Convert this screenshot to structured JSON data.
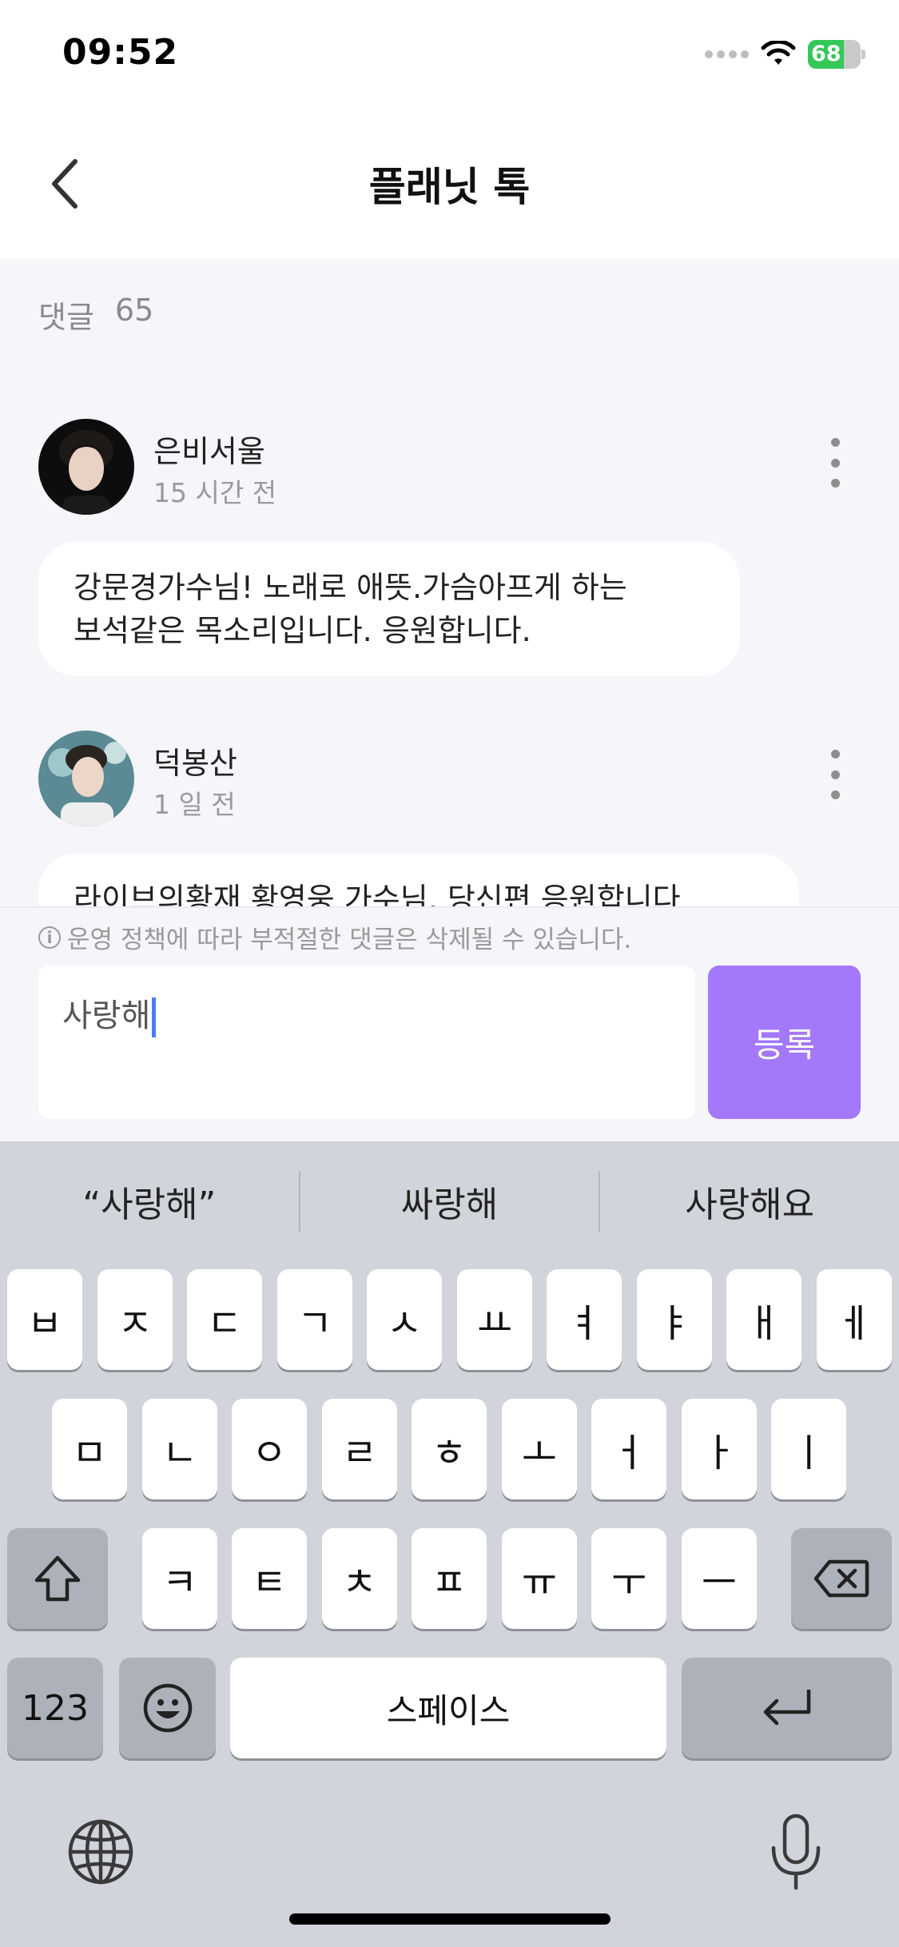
{
  "status_bar": {
    "time": "09:52",
    "battery_percent": "68",
    "battery_level": 0.68,
    "icons": [
      "signal-dots-icon",
      "wifi-icon",
      "battery-charging-icon"
    ]
  },
  "header": {
    "title": "플래닛 톡",
    "back_icon": "chevron-left-icon"
  },
  "comments": {
    "count_label": "댓글",
    "count": "65",
    "items": [
      {
        "name": "은비서울",
        "time": "15 시간 전",
        "text_line1": "강문경가수님! 노래로 애뜻.가슴아프게 하는",
        "text_line2": "보석같은 목소리입니다. 응원합니다."
      },
      {
        "name": "덕봉산",
        "time": "1 일 전",
        "text_line1": "라이브의황재 황영웅 가수님, 당신편 응원합니다"
      }
    ]
  },
  "notice": {
    "icon": "info-icon",
    "text": "운영 정책에 따라 부적절한 댓글은 삭제될 수 있습니다."
  },
  "input": {
    "value": "사랑해",
    "submit_label": "등록"
  },
  "keyboard": {
    "suggestions": [
      "“사랑해”",
      "싸랑해",
      "사랑해요"
    ],
    "row1": [
      "ㅂ",
      "ㅈ",
      "ㄷ",
      "ㄱ",
      "ㅅ",
      "ㅛ",
      "ㅕ",
      "ㅑ",
      "ㅐ",
      "ㅔ"
    ],
    "row2": [
      "ㅁ",
      "ㄴ",
      "ㅇ",
      "ㄹ",
      "ㅎ",
      "ㅗ",
      "ㅓ",
      "ㅏ",
      "ㅣ"
    ],
    "row3": [
      "ㅋ",
      "ㅌ",
      "ㅊ",
      "ㅍ",
      "ㅠ",
      "ㅜ",
      "ㅡ"
    ],
    "numbers_label": "123",
    "space_label": "스페이스",
    "icons": [
      "shift-icon",
      "delete-icon",
      "emoji-icon",
      "return-icon",
      "globe-icon",
      "microphone-icon"
    ]
  }
}
